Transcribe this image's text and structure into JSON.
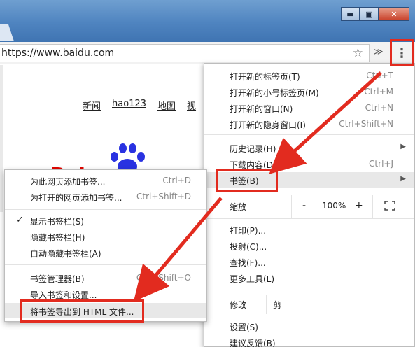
{
  "window": {
    "minimize": "▬",
    "maximize": "▣",
    "close": "✕"
  },
  "toolbar": {
    "url": "https://www.baidu.com",
    "star_icon": "star-icon",
    "extensions_icon": "chevron-double-icon",
    "menu_icon": "kebab-menu-icon"
  },
  "page": {
    "nav": [
      "新闻",
      "hao123",
      "地图",
      "视"
    ],
    "logo_text": "Bai"
  },
  "menu": {
    "items": [
      {
        "label": "打开新的标签页(T)",
        "shortcut": "Ctrl+T"
      },
      {
        "label": "打开新的小号标签页(M)",
        "shortcut": "Ctrl+M"
      },
      {
        "label": "打开新的窗口(N)",
        "shortcut": "Ctrl+N"
      },
      {
        "label": "打开新的隐身窗口(I)",
        "shortcut": "Ctrl+Shift+N"
      },
      {
        "label": "历史记录(H)",
        "shortcut": ""
      },
      {
        "label": "下载内容(D)",
        "shortcut": "Ctrl+J"
      },
      {
        "label": "书签(B)",
        "shortcut": ""
      },
      {
        "label": "打印(P)...",
        "shortcut": ""
      },
      {
        "label": "投射(C)...",
        "shortcut": ""
      },
      {
        "label": "查找(F)...",
        "shortcut": ""
      },
      {
        "label": "更多工具(L)",
        "shortcut": ""
      },
      {
        "label": "设置(S)",
        "shortcut": ""
      },
      {
        "label": "建议反馈(B)",
        "shortcut": ""
      }
    ],
    "zoom": {
      "label": "缩放",
      "minus": "-",
      "value": "100%",
      "plus": "+"
    },
    "edit": {
      "label": "修改",
      "cut": "剪"
    }
  },
  "submenu": {
    "items": [
      {
        "label": "为此网页添加书签...",
        "shortcut": "Ctrl+D"
      },
      {
        "label": "为打开的网页添加书签...",
        "shortcut": "Ctrl+Shift+D"
      },
      {
        "label": "显示书签栏(S)",
        "shortcut": "",
        "checked": "✓"
      },
      {
        "label": "隐藏书签栏(H)",
        "shortcut": ""
      },
      {
        "label": "自动隐藏书签栏(A)",
        "shortcut": ""
      },
      {
        "label": "书签管理器(B)",
        "shortcut": "Ctrl+Shift+O"
      },
      {
        "label": "导入书签和设置...",
        "shortcut": ""
      },
      {
        "label": "将书签导出到 HTML 文件...",
        "shortcut": ""
      }
    ]
  },
  "colors": {
    "highlight": "#e22b1f",
    "baidu_blue": "#2932e1",
    "baidu_red": "#e10601"
  }
}
